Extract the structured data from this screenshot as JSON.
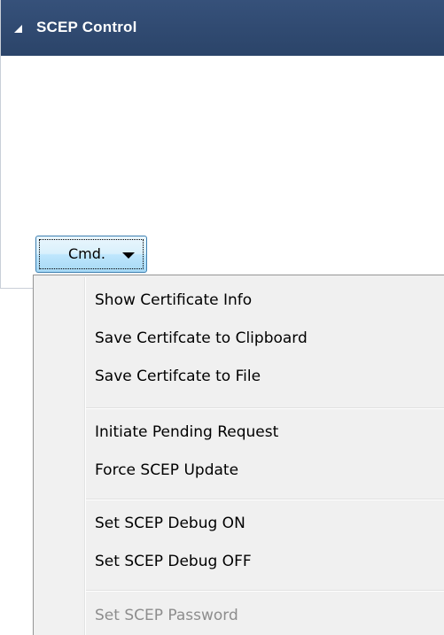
{
  "panel": {
    "title": "SCEP Control",
    "header_color": "#2f4a72",
    "collapse_icon": "triangle-collapse-icon"
  },
  "cmd_button": {
    "label": "Cmd.",
    "dropdown_icon": "chevron-down-icon"
  },
  "menu": {
    "groups": [
      [
        "Show Certificate Info",
        "Save Certifcate to Clipboard",
        "Save Certifcate to File"
      ],
      [
        "Initiate Pending Request",
        "Force SCEP Update"
      ],
      [
        "Set SCEP Debug ON",
        "Set SCEP Debug OFF"
      ],
      [
        "Set SCEP Password"
      ]
    ],
    "disabled_items": [
      "Set SCEP Password"
    ]
  }
}
